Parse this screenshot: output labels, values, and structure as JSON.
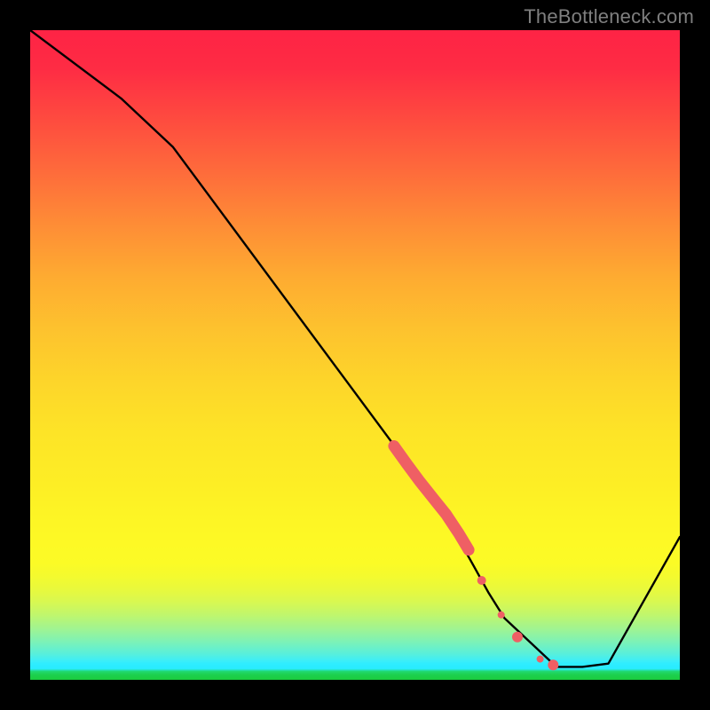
{
  "watermark": "TheBottleneck.com",
  "chart_data": {
    "type": "line",
    "title": "",
    "xlabel": "",
    "ylabel": "",
    "xlim": [
      0,
      100
    ],
    "ylim": [
      0,
      100
    ],
    "background_gradient": {
      "top": "#fe2345",
      "mid": "#fdee25",
      "bottom": "#1bcc3e"
    },
    "series": [
      {
        "name": "bottleneck-curve",
        "x": [
          0,
          14,
          22,
          63.5,
          68,
          70.5,
          73,
          81,
          85,
          89,
          100
        ],
        "y": [
          100,
          89.5,
          82,
          26,
          18,
          13.5,
          9.5,
          2,
          2,
          2.5,
          22
        ],
        "stroke": "#000000"
      }
    ],
    "highlight_segment": {
      "name": "thick-red-band",
      "color": "#ef5f64",
      "x": [
        56,
        58,
        60,
        62,
        64,
        66,
        67.5
      ],
      "y": [
        36,
        33.2,
        30.5,
        28,
        25.5,
        22.5,
        20
      ],
      "width": 13
    },
    "highlight_dots": {
      "color": "#ef5f64",
      "points": [
        {
          "x": 69.5,
          "y": 15.3,
          "r": 5
        },
        {
          "x": 72.5,
          "y": 10,
          "r": 4
        },
        {
          "x": 75,
          "y": 6.6,
          "r": 6
        },
        {
          "x": 78.5,
          "y": 3.2,
          "r": 4
        },
        {
          "x": 80.5,
          "y": 2.3,
          "r": 6
        }
      ]
    }
  }
}
